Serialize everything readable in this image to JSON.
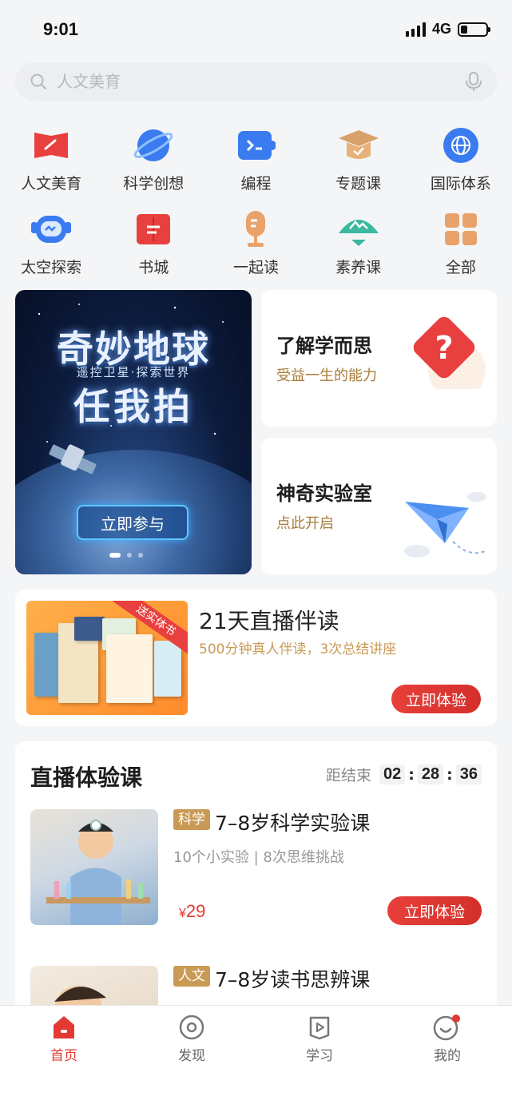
{
  "status_bar": {
    "time": "9:01",
    "network": "4G"
  },
  "search": {
    "placeholder": "人文美育"
  },
  "quick_menu": [
    {
      "label": "人文美育",
      "icon": "flag-icon",
      "color": "#e8403e"
    },
    {
      "label": "科学创想",
      "icon": "planet-icon",
      "color": "#3a7cf0"
    },
    {
      "label": "编程",
      "icon": "code-icon",
      "color": "#3a7cf0"
    },
    {
      "label": "专题课",
      "icon": "graduation-cap-icon",
      "color": "#d9a16a"
    },
    {
      "label": "国际体系",
      "icon": "globe-icon",
      "color": "#3a7cf0"
    },
    {
      "label": "太空探索",
      "icon": "robot-icon",
      "color": "#3a7cf0"
    },
    {
      "label": "书城",
      "icon": "book-icon",
      "color": "#e8403e"
    },
    {
      "label": "一起读",
      "icon": "microphone-icon",
      "color": "#e8a26a"
    },
    {
      "label": "素养课",
      "icon": "mountain-icon",
      "color": "#3ab8a0"
    },
    {
      "label": "全部",
      "icon": "grid-icon",
      "color": "#e8a26a"
    }
  ],
  "banner": {
    "title": "奇妙地球",
    "subtitle": "遥控卫星·探索世界",
    "title2": "任我拍",
    "button": "立即参与"
  },
  "promo_cards": [
    {
      "title": "了解学而思",
      "subtitle": "受益一生的能力",
      "icon": "question-mark-icon"
    },
    {
      "title": "神奇实验室",
      "subtitle": "点此开启",
      "icon": "paper-plane-icon"
    }
  ],
  "reading_plan": {
    "ribbon": "送实体书",
    "title": "21天直播伴读",
    "subtitle": "500分钟真人伴读，3次总结讲座",
    "button": "立即体验"
  },
  "live_section": {
    "title": "直播体验课",
    "countdown_label": "距结束",
    "countdown": {
      "hours": "02",
      "minutes": "28",
      "seconds": "36"
    },
    "courses": [
      {
        "tag": "科学",
        "title": "7–8岁科学实验课",
        "subtitle": "10个小实验 | 8次思维挑战",
        "price_symbol": "¥",
        "price": "29",
        "button": "立即体验"
      },
      {
        "tag": "人文",
        "title": "7–8岁读书思辨课"
      }
    ]
  },
  "tab_bar": [
    {
      "label": "首页",
      "icon": "home-icon",
      "active": true
    },
    {
      "label": "发现",
      "icon": "compass-icon",
      "active": false
    },
    {
      "label": "学习",
      "icon": "play-icon",
      "active": false
    },
    {
      "label": "我的",
      "icon": "profile-icon",
      "active": false
    }
  ],
  "colors": {
    "accent": "#e23a33",
    "gold": "#c99a55",
    "blue": "#3a7cf0"
  }
}
